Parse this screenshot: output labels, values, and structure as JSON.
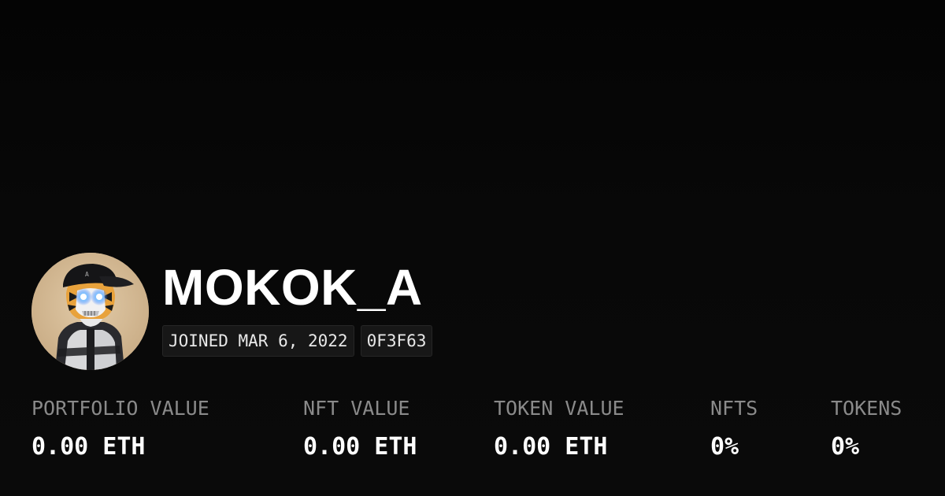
{
  "profile": {
    "username": "MOKOK_A",
    "joined": "JOINED MAR 6, 2022",
    "address": "0F3F63",
    "avatar_icon": "avatar-image"
  },
  "stats": [
    {
      "label": "PORTFOLIO VALUE",
      "value": "0.00 ETH"
    },
    {
      "label": "NFT VALUE",
      "value": "0.00 ETH"
    },
    {
      "label": "TOKEN VALUE",
      "value": "0.00 ETH"
    },
    {
      "label": "NFTS",
      "value": "0%"
    },
    {
      "label": "TOKENS",
      "value": "0%"
    }
  ],
  "colors": {
    "background": "#0a0a0a",
    "label": "#8a8a8a",
    "value": "#ffffff",
    "badge_bg": "#171717",
    "avatar_bg": "#d6bd9a",
    "eye_glow": "#3a8bff"
  }
}
